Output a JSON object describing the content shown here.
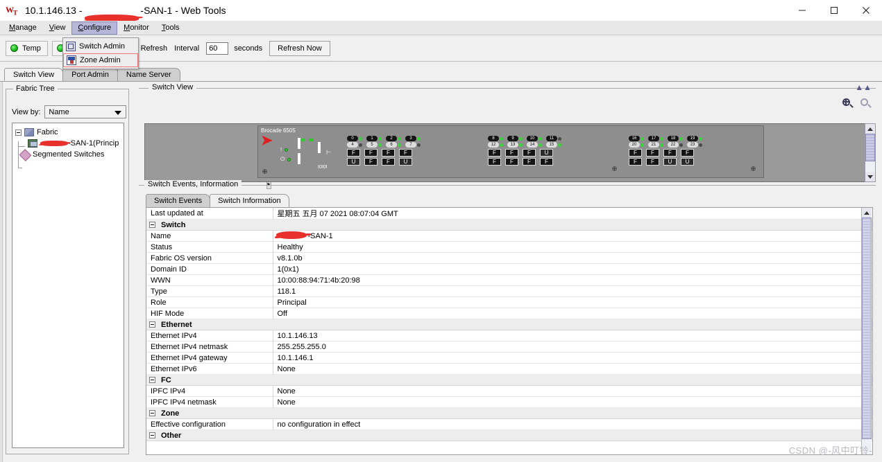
{
  "window": {
    "title": "10.1.146.13 - ████-SAN-1 - Web Tools",
    "title_prefix": "10.1.146.13 - ",
    "title_suffix": "-SAN-1 - Web Tools",
    "app_icon": "webtools-icon",
    "minimize": "–",
    "maximize": "□",
    "close": "✕"
  },
  "menubar": {
    "items": [
      {
        "label": "Manage",
        "active": false
      },
      {
        "label": "View",
        "active": false
      },
      {
        "label": "Configure",
        "active": true
      },
      {
        "label": "Monitor",
        "active": false
      },
      {
        "label": "Tools",
        "active": false
      }
    ]
  },
  "dropdown": {
    "open_for": "Configure",
    "items": [
      {
        "label": "Switch Admin",
        "icon": "switch-admin-icon",
        "selected": false
      },
      {
        "label": "Zone Admin",
        "icon": "zone-admin-icon",
        "selected": true
      }
    ],
    "highlight_color": "#e87777"
  },
  "toolbar": {
    "status_buttons": [
      {
        "label": "Temp",
        "led": "green"
      },
      {
        "label": "",
        "led": "green"
      }
    ],
    "auto_refresh_label": "Auto Refresh",
    "auto_refresh_checked": true,
    "interval_label": "Interval",
    "interval_value": "60",
    "seconds_label": "seconds",
    "refresh_now_label": "Refresh Now"
  },
  "tabs": [
    {
      "label": "Switch View",
      "active": true
    },
    {
      "label": "Port Admin",
      "active": false
    },
    {
      "label": "Name Server",
      "active": false
    }
  ],
  "sidebar": {
    "group_title": "Fabric Tree",
    "view_by_label": "View by:",
    "view_by_value": "Name",
    "tree": [
      {
        "label": "Fabric",
        "level": 0,
        "icon": "fabric-icon",
        "expander": true
      },
      {
        "label": "-SAN-1(Princip",
        "level": 1,
        "icon": "switch-icon",
        "redacted": true
      },
      {
        "label": "Segmented Switches",
        "level": 1,
        "icon": "segmented-switches-icon"
      }
    ]
  },
  "switch_view": {
    "title": "Switch View",
    "zoom_in_icon": "zoom-in-icon",
    "zoom_out_icon": "zoom-out-icon",
    "collapse_icon": "chevron-collapse-icon",
    "chassis": {
      "model_label": "Brocade 6505",
      "vendor_logo": "brocade-logo",
      "alert_icon": "alert-icon",
      "power_icon": "power-icon",
      "serial_label": "I0I0I",
      "usb_icon": "usb-icon",
      "port_groups": [
        {
          "top_numbers": [
            "0",
            "1",
            "2",
            "3"
          ],
          "top_leds": [
            "on",
            "on",
            "on",
            "on"
          ],
          "bottom_numbers": [
            "4",
            "5",
            "6",
            "7"
          ],
          "bottom_leds": [
            "off",
            "on",
            "on",
            "off"
          ],
          "top_ports": [
            "F",
            "F",
            "F",
            "F"
          ],
          "bottom_ports": [
            "U",
            "F",
            "F",
            "U"
          ]
        },
        {
          "top_numbers": [
            "8",
            "9",
            "10",
            "11"
          ],
          "top_leds": [
            "on",
            "on",
            "on",
            "off"
          ],
          "bottom_numbers": [
            "12",
            "13",
            "14",
            "15"
          ],
          "bottom_leds": [
            "on",
            "on",
            "on",
            "on"
          ],
          "top_ports": [
            "F",
            "F",
            "F",
            "U"
          ],
          "bottom_ports": [
            "F",
            "F",
            "F",
            "F"
          ]
        },
        {
          "top_numbers": [
            "16",
            "17",
            "18",
            "19"
          ],
          "top_leds": [
            "on",
            "on",
            "on",
            "on"
          ],
          "bottom_numbers": [
            "20",
            "21",
            "22",
            "23"
          ],
          "bottom_leds": [
            "on",
            "on",
            "off",
            "off"
          ],
          "top_ports": [
            "F",
            "F",
            "F",
            "F"
          ],
          "bottom_ports": [
            "F",
            "F",
            "U",
            "U"
          ]
        }
      ]
    }
  },
  "events_panel": {
    "title": "Switch Events, Information",
    "subtabs": [
      {
        "label": "Switch Events",
        "active": false
      },
      {
        "label": "Switch Information",
        "active": true
      }
    ],
    "rows": [
      {
        "type": "row",
        "key": "Last updated at",
        "value": "星期五 五月 07 2021 08:07:04 GMT"
      },
      {
        "type": "section",
        "key": "Switch",
        "value": ""
      },
      {
        "type": "row",
        "key": "Name",
        "value": "-SAN-1",
        "redacted": true
      },
      {
        "type": "row",
        "key": "Status",
        "value": "Healthy"
      },
      {
        "type": "row",
        "key": "Fabric OS version",
        "value": "v8.1.0b"
      },
      {
        "type": "row",
        "key": "Domain ID",
        "value": "1(0x1)"
      },
      {
        "type": "row",
        "key": "WWN",
        "value": "10:00:88:94:71:4b:20:98"
      },
      {
        "type": "row",
        "key": "Type",
        "value": "118.1"
      },
      {
        "type": "row",
        "key": "Role",
        "value": "Principal"
      },
      {
        "type": "row",
        "key": "HIF Mode",
        "value": "Off"
      },
      {
        "type": "section",
        "key": "Ethernet",
        "value": ""
      },
      {
        "type": "row",
        "key": "Ethernet IPv4",
        "value": "10.1.146.13"
      },
      {
        "type": "row",
        "key": "Ethernet IPv4 netmask",
        "value": "255.255.255.0"
      },
      {
        "type": "row",
        "key": "Ethernet IPv4 gateway",
        "value": "10.1.146.1"
      },
      {
        "type": "row",
        "key": "Ethernet IPv6",
        "value": "None"
      },
      {
        "type": "section",
        "key": "FC",
        "value": ""
      },
      {
        "type": "row",
        "key": "IPFC IPv4",
        "value": "None"
      },
      {
        "type": "row",
        "key": "IPFC IPv4 netmask",
        "value": "None"
      },
      {
        "type": "section",
        "key": "Zone",
        "value": ""
      },
      {
        "type": "row",
        "key": "Effective configuration",
        "value": "no configuration in effect"
      },
      {
        "type": "section",
        "key": "Other",
        "value": ""
      }
    ]
  },
  "watermark": {
    "text": "CSDN @-风中叮铃-"
  },
  "colors": {
    "accent": "#b6b6d8",
    "redaction": "#e8312c",
    "led_green": "#32c832",
    "panel_bg": "#f0f0f0",
    "chassis_bg": "#8e8e8e"
  }
}
